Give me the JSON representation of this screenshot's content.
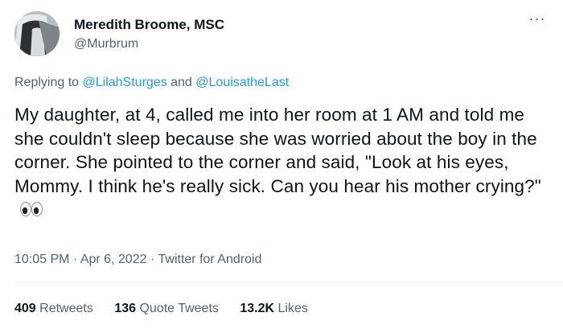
{
  "author": {
    "display_name": "Meredith Broome, MSC",
    "handle": "@Murbrum",
    "avatar_icon": "profile-photo-icon"
  },
  "more_icon": "more-options-icon",
  "reply": {
    "prefix": "Replying to ",
    "mention_1": "@LilahSturges",
    "joiner": " and ",
    "mention_2": "@LouisatheLast"
  },
  "tweet_text": "My daughter, at 4, called me into her room at 1 AM and told me she couldn't sleep because she was worried about the boy in the corner. She pointed to the corner and said, \"Look at his eyes, Mommy. I think he's really sick. Can you hear his mother crying?\"",
  "emoji": "eyes-emoji-icon",
  "meta": {
    "time": "10:05 PM",
    "sep1": " · ",
    "date": "Apr 6, 2022",
    "sep2": " · ",
    "source": "Twitter for Android"
  },
  "stats": {
    "retweets_count": "409",
    "retweets_label": "Retweets",
    "quotes_count": "136",
    "quotes_label": "Quote Tweets",
    "likes_count": "13.2K",
    "likes_label": "Likes"
  },
  "colors": {
    "text": "#0f1419",
    "secondary": "#536471",
    "link": "#1d9bf0",
    "divider": "#eff3f4"
  }
}
